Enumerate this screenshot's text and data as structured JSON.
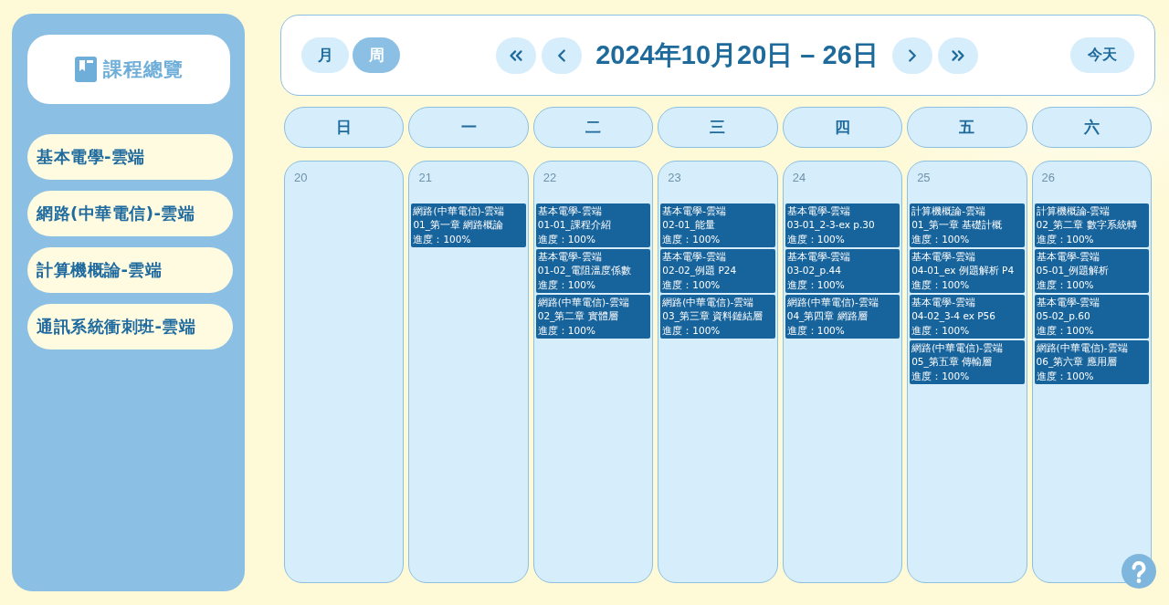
{
  "sidebar": {
    "title": "課程總覽",
    "courses": [
      {
        "label": "基本電學-雲端"
      },
      {
        "label": "網路(中華電信)-雲端"
      },
      {
        "label": "計算機概論-雲端"
      },
      {
        "label": "通訊系統衝刺班-雲端"
      }
    ]
  },
  "toolbar": {
    "view_modes": [
      {
        "label": "月",
        "selected": false
      },
      {
        "label": "周",
        "selected": true
      }
    ],
    "date_range": "2024年10月20日 – 26日",
    "today_button": "今天"
  },
  "weekdays": [
    "日",
    "一",
    "二",
    "三",
    "四",
    "五",
    "六"
  ],
  "days": [
    {
      "date": "20"
    },
    {
      "date": "21",
      "events": [
        {
          "course": "網路(中華電信)-雲端",
          "lesson": "01_第一章 網路概論",
          "progress": "進度：100%"
        }
      ]
    },
    {
      "date": "22",
      "events": [
        {
          "course": "基本電學-雲端",
          "lesson": "01-01_課程介紹",
          "progress": "進度：100%"
        },
        {
          "course": "基本電學-雲端",
          "lesson": "01-02_電阻溫度係數",
          "progress": "進度：100%"
        },
        {
          "course": "網路(中華電信)-雲端",
          "lesson": "02_第二章 實體層",
          "progress": "進度：100%"
        }
      ]
    },
    {
      "date": "23",
      "events": [
        {
          "course": "基本電學-雲端",
          "lesson": "02-01_能量",
          "progress": "進度：100%"
        },
        {
          "course": "基本電學-雲端",
          "lesson": "02-02_例題 P24",
          "progress": "進度：100%"
        },
        {
          "course": "網路(中華電信)-雲端",
          "lesson": "03_第三章 資料鏈結層",
          "progress": "進度：100%"
        }
      ]
    },
    {
      "date": "24",
      "events": [
        {
          "course": "基本電學-雲端",
          "lesson": "03-01_2-3-ex p.30",
          "progress": "進度：100%"
        },
        {
          "course": "基本電學-雲端",
          "lesson": "03-02_p.44",
          "progress": "進度：100%"
        },
        {
          "course": "網路(中華電信)-雲端",
          "lesson": "04_第四章 網路層",
          "progress": "進度：100%"
        }
      ]
    },
    {
      "date": "25",
      "events": [
        {
          "course": "計算機概論-雲端",
          "lesson": "01_第一章 基礎計概",
          "progress": "進度：100%"
        },
        {
          "course": "基本電學-雲端",
          "lesson": "04-01_ex 例題解析 P4",
          "progress": "進度：100%"
        },
        {
          "course": "基本電學-雲端",
          "lesson": "04-02_3-4 ex P56",
          "progress": "進度：100%"
        },
        {
          "course": "網路(中華電信)-雲端",
          "lesson": "05_第五章 傳輸層",
          "progress": "進度：100%"
        }
      ]
    },
    {
      "date": "26",
      "events": [
        {
          "course": "計算機概論-雲端",
          "lesson": "02_第二章 數字系統轉",
          "progress": "進度：100%"
        },
        {
          "course": "基本電學-雲端",
          "lesson": "05-01_例題解析",
          "progress": "進度：100%"
        },
        {
          "course": "基本電學-雲端",
          "lesson": "05-02_p.60",
          "progress": "進度：100%"
        },
        {
          "course": "網路(中華電信)-雲端",
          "lesson": "06_第六章 應用層",
          "progress": "進度：100%"
        }
      ]
    }
  ]
}
